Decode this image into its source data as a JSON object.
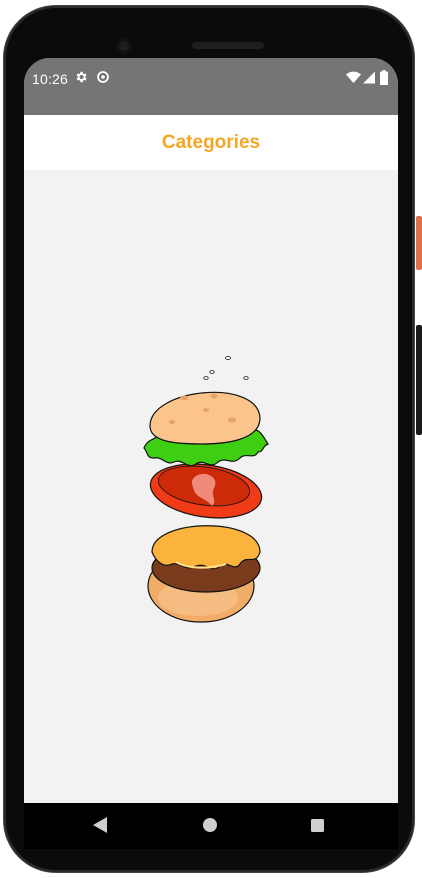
{
  "status_bar": {
    "time": "10:26",
    "icons": [
      "settings-icon",
      "data-saver-icon",
      "wifi-icon",
      "signal-icon",
      "battery-icon"
    ]
  },
  "app_bar": {
    "title": "Categories"
  },
  "content": {
    "illustration": "burger-illustration"
  },
  "nav_bar": {
    "buttons": [
      "back-icon",
      "home-icon",
      "recents-icon"
    ]
  },
  "colors": {
    "accent": "#f5a623",
    "status_bar": "#757575",
    "background": "#f2f2f2"
  }
}
